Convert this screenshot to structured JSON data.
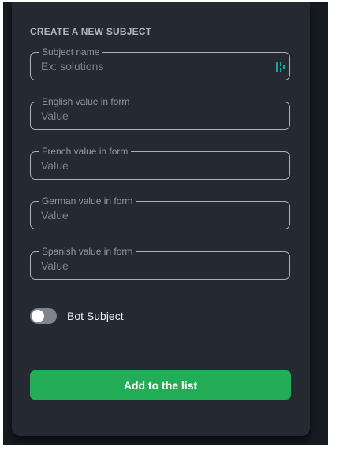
{
  "form": {
    "title": "CREATE A NEW SUBJECT",
    "subject_name": {
      "label": "Subject name",
      "placeholder": "Ex: solutions",
      "value": "",
      "extension_icon": "password-manager-icon"
    },
    "english": {
      "label": "English value in form",
      "placeholder": "Value",
      "value": ""
    },
    "french": {
      "label": "French value in form",
      "placeholder": "Value",
      "value": ""
    },
    "german": {
      "label": "German value in form",
      "placeholder": "Value",
      "value": ""
    },
    "spanish": {
      "label": "Spanish value in form",
      "placeholder": "Value",
      "value": ""
    },
    "bot_subject": {
      "label": "Bot Subject",
      "checked": false
    },
    "submit_label": "Add to the list"
  },
  "colors": {
    "background": "#161b21",
    "panel": "#252a32",
    "field_border": "#a9b0ba",
    "accent": "#22ad56",
    "extension_icon": "#1aa6a0"
  }
}
